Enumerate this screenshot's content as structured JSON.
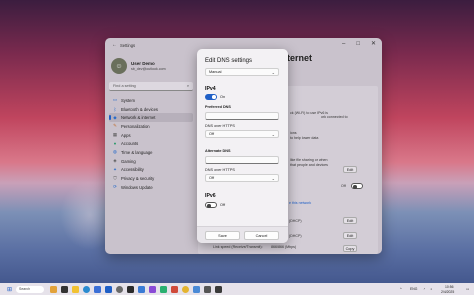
{
  "colors": {
    "accent": "#1f5fc6",
    "window_bg": "#c9c2cc",
    "dialog_bg": "#f3f1f4"
  },
  "settings": {
    "title": "Settings",
    "profile": {
      "name": "User Demo",
      "email": "sb_dev@outlook.com",
      "avatar_icon": "user-avatar"
    },
    "search_placeholder": "Find a setting",
    "nav": [
      {
        "label": "System",
        "icon": "monitor-icon"
      },
      {
        "label": "Bluetooth & devices",
        "icon": "bluetooth-icon"
      },
      {
        "label": "Network & internet",
        "icon": "wifi-icon",
        "active": true
      },
      {
        "label": "Personalization",
        "icon": "brush-icon"
      },
      {
        "label": "Apps",
        "icon": "apps-icon"
      },
      {
        "label": "Accounts",
        "icon": "person-icon"
      },
      {
        "label": "Time & language",
        "icon": "globe-icon"
      },
      {
        "label": "Gaming",
        "icon": "gamepad-icon"
      },
      {
        "label": "Accessibility",
        "icon": "accessibility-icon"
      },
      {
        "label": "Privacy & security",
        "icon": "shield-icon"
      },
      {
        "label": "Windows Update",
        "icon": "update-icon"
      }
    ],
    "page_title_fragment": "ternet",
    "right": {
      "text1": "ck (Wi-Fi) to use IPv6 is",
      "text2": "ork connected to",
      "text3": "ions",
      "text4": "to help lower data",
      "text5": "like file sharing or when",
      "text6": "that people and devices",
      "toggle_label": "Off",
      "link": "e this network",
      "dhcp1": "(DHCP)",
      "dhcp2": "(DHCP)",
      "link_speed": "Link speed (Receive/Transmit):",
      "link_speed_value": "866/866 (Mbps)",
      "edit_label": "Edit",
      "copy_label": "Copy"
    }
  },
  "dialog": {
    "title": "Edit DNS settings",
    "mode_select": "Manual",
    "ipv4": {
      "heading": "IPv4",
      "toggle_state": "On",
      "preferred_label": "Preferred DNS",
      "preferred_https_label": "DNS over HTTPS",
      "preferred_https_value": "Off",
      "alternate_label": "Alternate DNS",
      "alternate_https_label": "DNS over HTTPS",
      "alternate_https_value": "Off"
    },
    "ipv6": {
      "heading": "IPv6",
      "toggle_state": "Off"
    },
    "save_label": "Save",
    "cancel_label": "Cancel"
  },
  "taskbar": {
    "search_label": "Search",
    "lang": "ENG",
    "time": "10:56",
    "date": "2/4/2025"
  }
}
